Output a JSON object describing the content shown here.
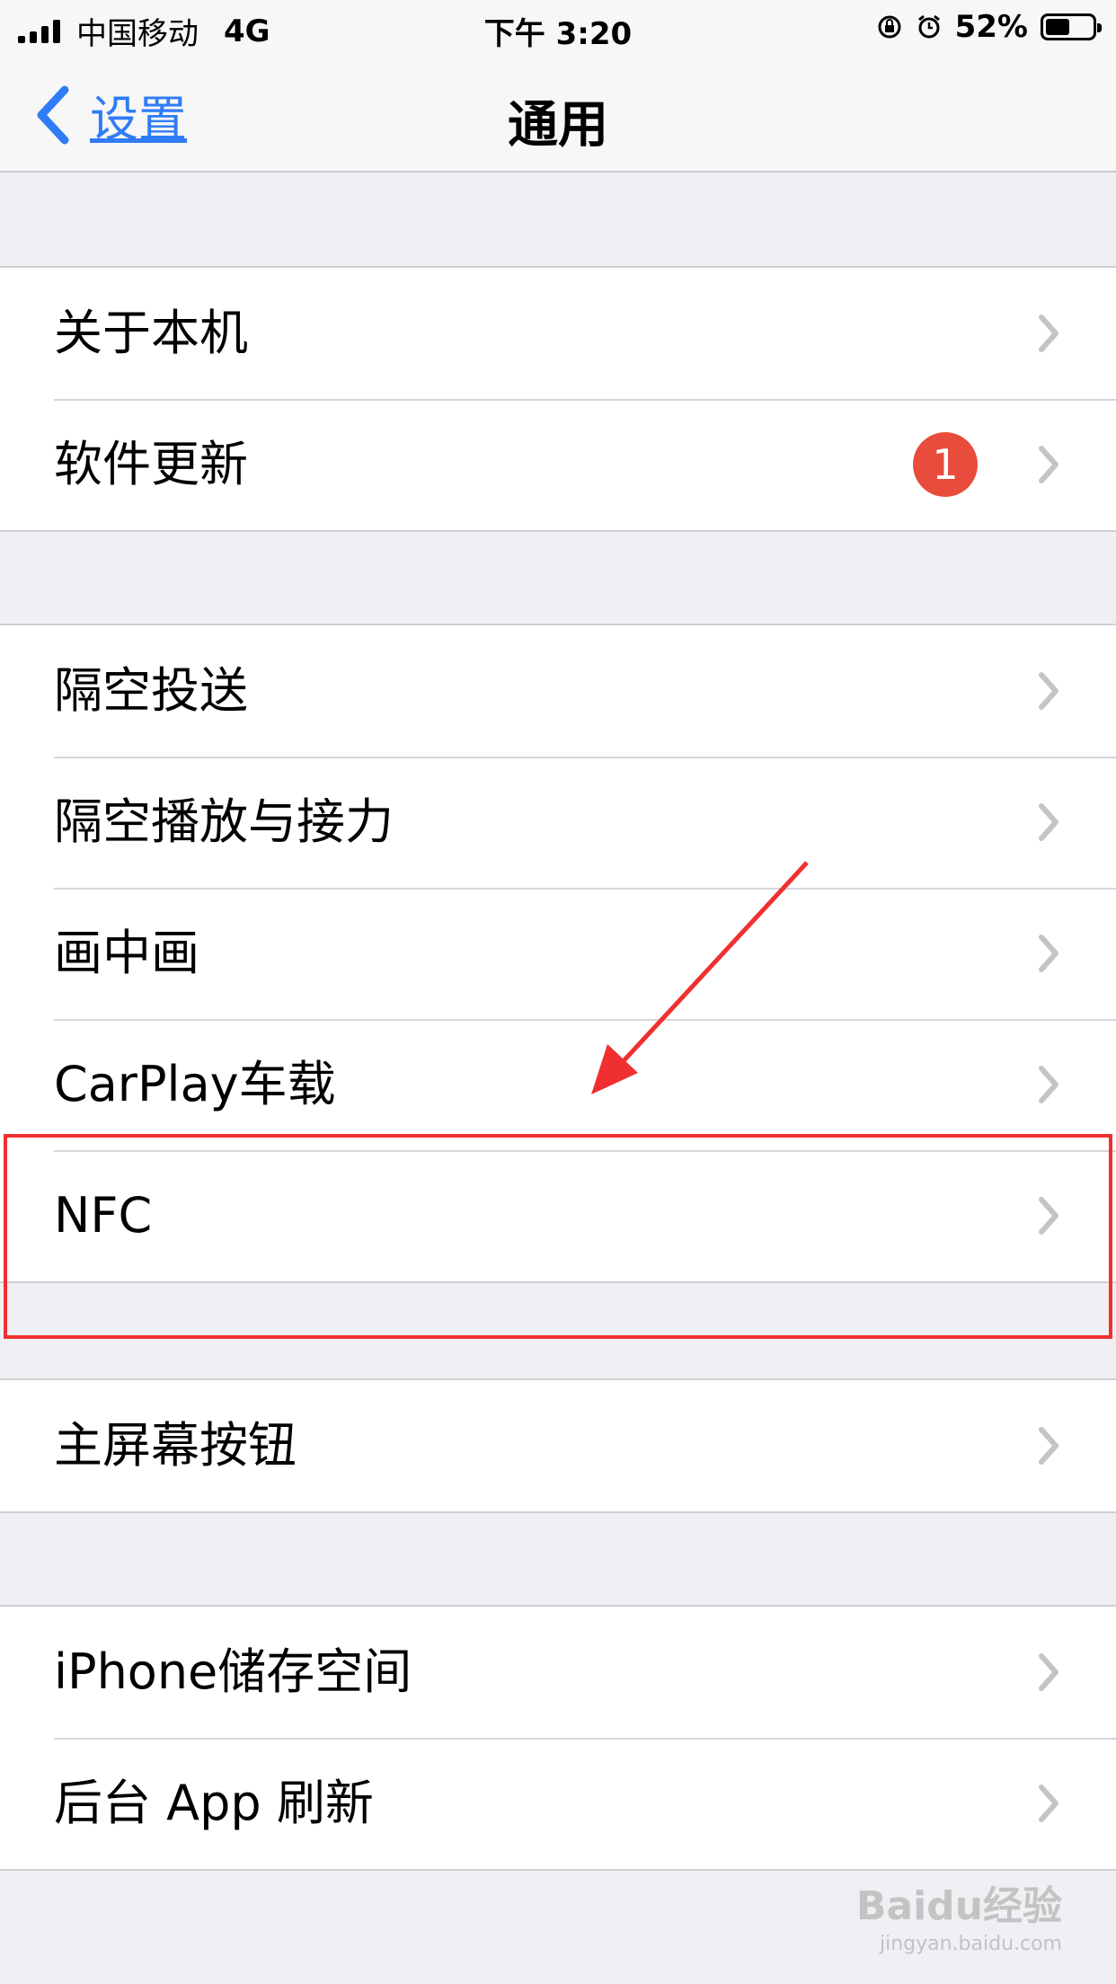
{
  "status_bar": {
    "carrier": "中国移动",
    "network": "4G",
    "time": "下午 3:20",
    "battery": "52%",
    "battery_level": 0.52
  },
  "nav": {
    "back_label": "设置",
    "title": "通用"
  },
  "groups": [
    {
      "items": [
        {
          "label": "关于本机"
        },
        {
          "label": "软件更新",
          "badge": "1"
        }
      ]
    },
    {
      "items": [
        {
          "label": "隔空投送"
        },
        {
          "label": "隔空播放与接力"
        },
        {
          "label": "画中画"
        },
        {
          "label": "CarPlay车载"
        },
        {
          "label": "NFC"
        }
      ]
    },
    {
      "items": [
        {
          "label": "主屏幕按钮"
        }
      ]
    },
    {
      "items": [
        {
          "label": "iPhone储存空间"
        },
        {
          "label": "后台 App 刷新"
        }
      ]
    }
  ],
  "watermark": {
    "text": "Baidu经验",
    "url": "jingyan.baidu.com"
  },
  "colors": {
    "accent": "#2f7cf6",
    "badge": "#e84c3d",
    "annotation": "#f03030"
  }
}
